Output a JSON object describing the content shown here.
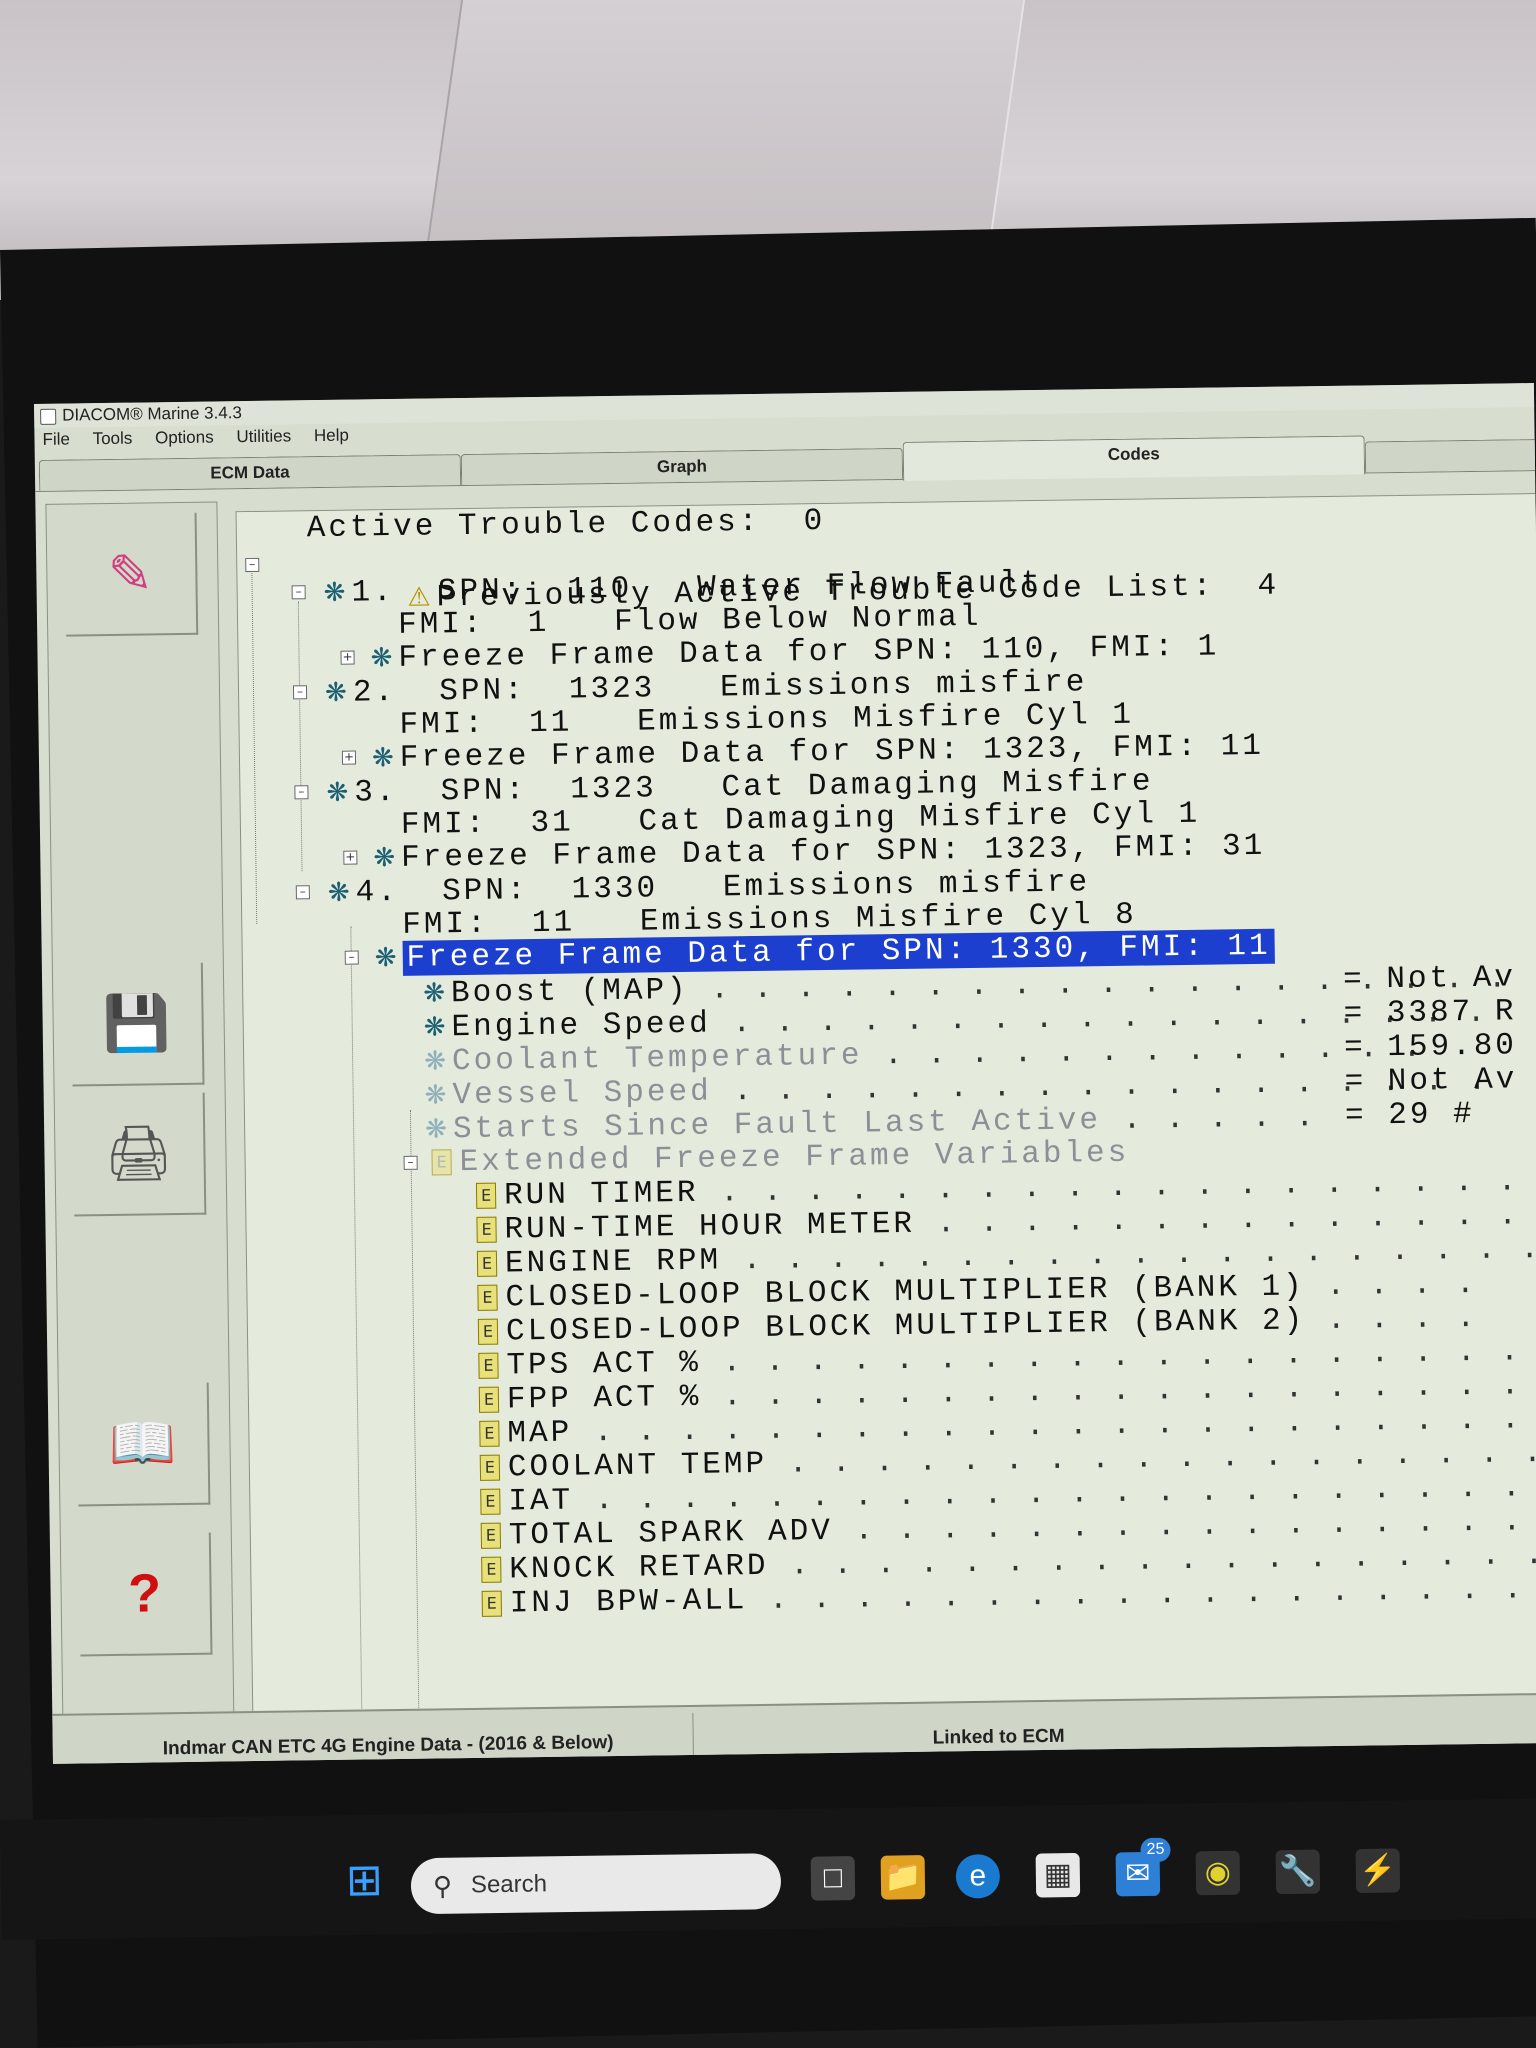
{
  "window": {
    "title": "DIACOM® Marine 3.4.3"
  },
  "menu": [
    "File",
    "Tools",
    "Options",
    "Utilities",
    "Help"
  ],
  "tabs": [
    "ECM Data",
    "Graph",
    "Codes"
  ],
  "tree": {
    "active_codes": "Active Trouble Codes:  0",
    "previous_header": "Previously Active Trouble Code List:  4",
    "codes": [
      {
        "index": "1.",
        "spn": "SPN:  110   Water Flow Fault",
        "fmi": "FMI:  1   Flow Below Normal",
        "freeze": "Freeze Frame Data for SPN: 110, FMI: 1"
      },
      {
        "index": "2.",
        "spn": "SPN:  1323   Emissions misfire",
        "fmi": "FMI:  11   Emissions Misfire Cyl 1",
        "freeze": "Freeze Frame Data for SPN: 1323, FMI: 11"
      },
      {
        "index": "3.",
        "spn": "SPN:  1323   Cat Damaging Misfire",
        "fmi": "FMI:  31   Cat Damaging Misfire Cyl 1",
        "freeze": "Freeze Frame Data for SPN: 1323, FMI: 31"
      },
      {
        "index": "4.",
        "spn": "SPN:  1330   Emissions misfire",
        "fmi": "FMI:  11   Emissions Misfire Cyl 8",
        "freeze": "Freeze Frame Data for SPN: 1330, FMI: 11"
      }
    ],
    "freeze_items": [
      {
        "label": "Boost (MAP)",
        "value": "= Not Av"
      },
      {
        "label": "Engine Speed",
        "value": "= 3387 R"
      },
      {
        "label": "Coolant Temperature",
        "value": "= 159.80"
      },
      {
        "label": "Vessel Speed",
        "value": "= Not Av"
      },
      {
        "label": "Starts Since Fault Last Active",
        "value": "= 29 #"
      }
    ],
    "extended_header": "Extended Freeze Frame Variables",
    "extended_items": [
      "RUN TIMER",
      "RUN-TIME HOUR METER",
      "ENGINE RPM",
      "CLOSED-LOOP BLOCK MULTIPLIER (BANK 1)",
      "CLOSED-LOOP BLOCK MULTIPLIER (BANK 2)",
      "TPS ACT %",
      "FPP ACT %",
      "MAP",
      "COOLANT TEMP",
      "IAT",
      "TOTAL SPARK ADV",
      "KNOCK RETARD",
      "INJ BPW-ALL"
    ]
  },
  "statusbar": {
    "engine": "Indmar CAN ETC 4G Engine Data - (2016 & Below)",
    "link": "Linked to ECM"
  },
  "taskbar": {
    "search_placeholder": "Search",
    "mail_badge": "25"
  },
  "icons": [
    "pencil-icon",
    "save-icon",
    "print-icon",
    "manual-icon",
    "help-icon"
  ],
  "colors": {
    "selection": "#1d3fcf",
    "gear": "#1c5f72",
    "window_bg": "#d7decf"
  }
}
